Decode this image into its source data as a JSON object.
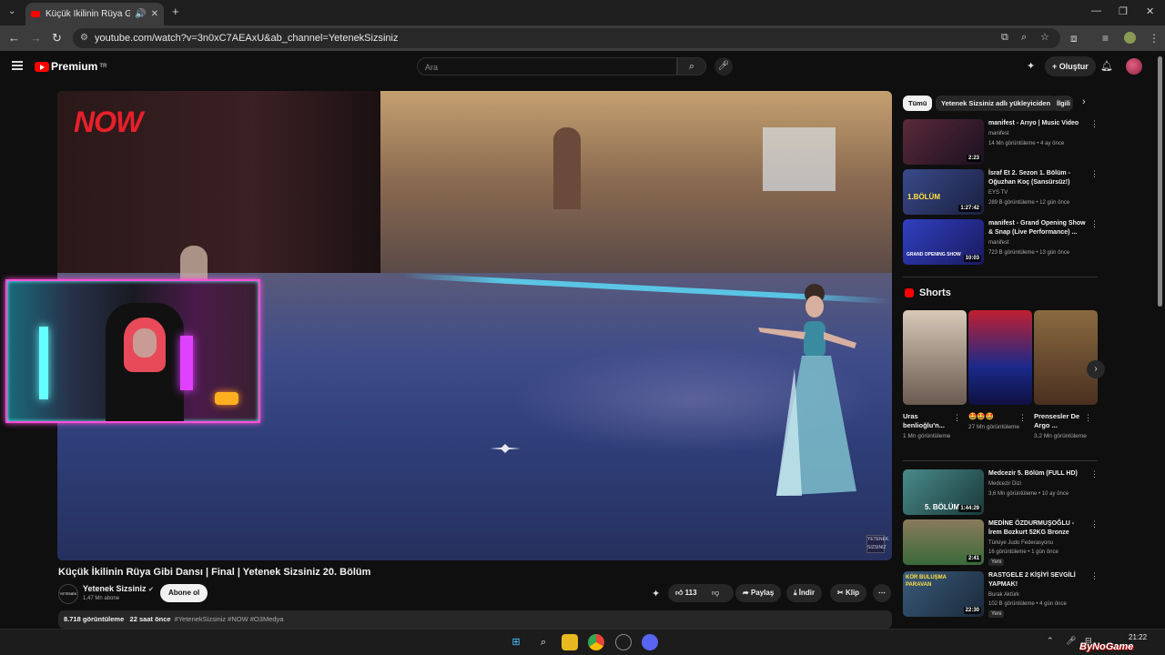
{
  "browser": {
    "tab_title": "Küçük İkilinin Rüya Gibi Dans",
    "url": "youtube.com/watch?v=3n0xC7AEAxU&ab_channel=YetenekSizsiniz"
  },
  "header": {
    "logo_text": "Premium",
    "logo_sup": "TR",
    "search_placeholder": "Ara",
    "create_label": "Oluştur"
  },
  "player": {
    "overlay_logo": "NOW",
    "watermark": "YETENEK SIZSINIZ"
  },
  "video": {
    "title": "Küçük İkilinin Rüya Gibi Dansı | Final | Yetenek Sizsiniz 20. Bölüm",
    "channel": "Yetenek Sizsiniz",
    "channel_badge": "YETENEK SIZSINIZ",
    "subscribers": "1,47 Mn abone",
    "subscribe_label": "Abone ol",
    "likes": "113",
    "share_label": "Paylaş",
    "download_label": "İndir",
    "clip_label": "Klip",
    "views": "8.718 görüntüleme",
    "age": "22 saat önce",
    "tags": "#YetenekSizsiniz #NOW #O3Medya"
  },
  "sidebar": {
    "chips": [
      "Tümü",
      "Yetenek Sizsiniz adlı yükleyiciden",
      "İlgili"
    ],
    "recs_top": [
      {
        "title": "manifest - Arıyo | Music Video",
        "channel": "manifest",
        "meta": "14 Mn görüntüleme • 4 ay önce",
        "duration": "2:23",
        "color": "#3a2030"
      },
      {
        "title": "İsraf Et 2. Sezon 1. Bölüm - Oğuzhan Koç (Sansürsüz!)",
        "channel": "EYS TV",
        "meta": "289 B görüntüleme • 12 gün önce",
        "duration": "1:27:42",
        "thumb_text": "1.BÖLÜM",
        "color": "#2a3a6a"
      },
      {
        "title": "manifest - Grand Opening Show & Snap (Live Performance) ...",
        "channel": "manifest",
        "meta": "723 B görüntüleme • 13 gün önce",
        "duration": "10:03",
        "thumb_text": "GRAND OPENING SHOW",
        "color": "#2a30a0"
      }
    ],
    "shorts_title": "Shorts",
    "shorts": [
      {
        "title": "Uras benlioğlu'n...",
        "views": "1 Mn görüntüleme",
        "color": "#7a6a5a"
      },
      {
        "title": "🤩🤩🤩",
        "views": "27 Mn görüntüleme",
        "color": "#1a3a8a"
      },
      {
        "title": "Prensesler De Argo ...",
        "views": "3,2 Mn görüntüleme",
        "color": "#6a4a30"
      }
    ],
    "recs_bottom": [
      {
        "title": "Medcezir 5. Bölüm (FULL HD)",
        "channel": "Medcezir Dizi",
        "meta": "3,6 Mn görüntüleme • 10 ay önce",
        "duration": "1:44:29",
        "thumb_text": "5. BÖLÜM",
        "color": "#2a6a6a"
      },
      {
        "title": "MEDİNE ÖZDURMUŞOĞLU - İrem Bozkurt 52KG Bronze",
        "channel": "Türkiye Judo Federasyonu",
        "meta": "16 görüntüleme • 1 gün önce",
        "duration": "2:41",
        "badge": "Yeni",
        "color": "#6a5a3a"
      },
      {
        "title": "RASTGELE 2 KİŞİYİ SEVGİLİ YAPMAK!",
        "channel": "Burak Aktürk",
        "meta": "102 B görüntüleme • 4 gün önce",
        "duration": "22:30",
        "badge": "Yeni",
        "thumb_text": "KÖR BULUŞMA PARAVAN",
        "color": "#2a4a6a"
      }
    ]
  },
  "taskbar": {
    "time": "21:22",
    "brand": "ByNoGame"
  }
}
